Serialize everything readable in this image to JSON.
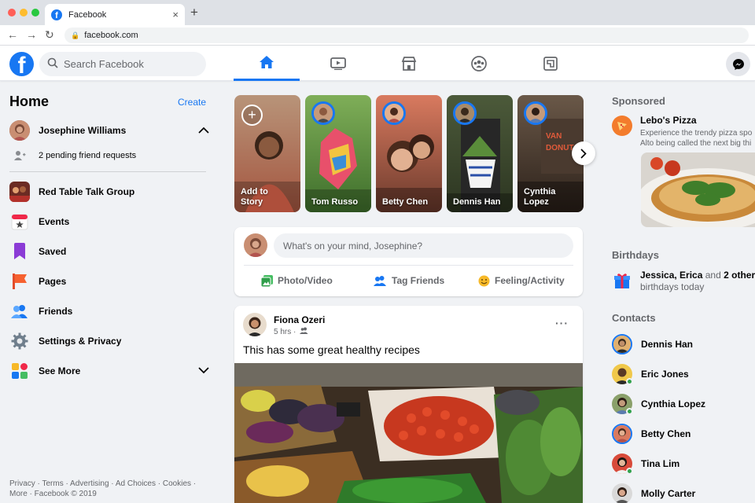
{
  "browser": {
    "tab_title": "Facebook",
    "tab_close": "×",
    "new_tab": "+",
    "url": "facebook.com",
    "back": "←",
    "forward": "→",
    "reload": "↻"
  },
  "header": {
    "logo_letter": "f",
    "search_placeholder": "Search Facebook",
    "nav_tabs": [
      {
        "name": "home",
        "icon": "home-icon",
        "active": true
      },
      {
        "name": "watch",
        "icon": "video-icon",
        "active": false
      },
      {
        "name": "marketplace",
        "icon": "marketplace-icon",
        "active": false
      },
      {
        "name": "groups",
        "icon": "groups-icon",
        "active": false
      },
      {
        "name": "gaming",
        "icon": "gaming-icon",
        "active": false
      }
    ],
    "messenger_icon": "messenger-icon"
  },
  "left": {
    "title": "Home",
    "create": "Create",
    "profile_name": "Josephine Williams",
    "pending_requests": "2 pending friend requests",
    "items": [
      {
        "label": "Red Table Talk Group",
        "icon": "group-avatar-icon"
      },
      {
        "label": "Events",
        "icon": "calendar-icon"
      },
      {
        "label": "Saved",
        "icon": "bookmark-icon"
      },
      {
        "label": "Pages",
        "icon": "flag-icon"
      },
      {
        "label": "Friends",
        "icon": "friends-icon"
      },
      {
        "label": "Settings & Privacy",
        "icon": "gear-icon"
      },
      {
        "label": "See More",
        "icon": "grid-icon"
      }
    ],
    "footer": "Privacy · Terms · Advertising · Ad Choices · Cookies · More · Facebook © 2019"
  },
  "stories": [
    {
      "name": "Add to Story",
      "line1": "Add to",
      "line2": "Story"
    },
    {
      "name": "Tom Russo"
    },
    {
      "name": "Betty Chen"
    },
    {
      "name": "Dennis Han"
    },
    {
      "name": "Cynthia Lopez",
      "line1": "Cynthia",
      "line2": "Lopez"
    }
  ],
  "composer": {
    "placeholder": "What's on your mind, Josephine?",
    "actions": [
      "Photo/Video",
      "Tag Friends",
      "Feeling/Activity"
    ]
  },
  "post": {
    "author": "Fiona Ozeri",
    "time": "5 hrs ·",
    "text": "This has some great healthy recipes",
    "more": "···"
  },
  "right": {
    "sponsored_title": "Sponsored",
    "ad_name": "Lebo's Pizza",
    "ad_desc_1": "Experience the trendy pizza spo",
    "ad_desc_2": "Alto being called the next big thi",
    "birthdays_title": "Birthdays",
    "bday_names": "Jessica, Erica",
    "bday_and": " and ",
    "bday_others": "2 others",
    "bday_today": "birthdays today",
    "contacts_title": "Contacts",
    "contacts": [
      {
        "name": "Dennis Han",
        "online": false,
        "story": true
      },
      {
        "name": "Eric Jones",
        "online": true,
        "story": false
      },
      {
        "name": "Cynthia Lopez",
        "online": true,
        "story": false
      },
      {
        "name": "Betty Chen",
        "online": false,
        "story": true
      },
      {
        "name": "Tina Lim",
        "online": true,
        "story": false
      },
      {
        "name": "Molly Carter",
        "online": false,
        "story": false
      }
    ]
  },
  "colors": {
    "brand": "#1877f2",
    "bg": "#f0f2f5",
    "online": "#31a24c"
  }
}
